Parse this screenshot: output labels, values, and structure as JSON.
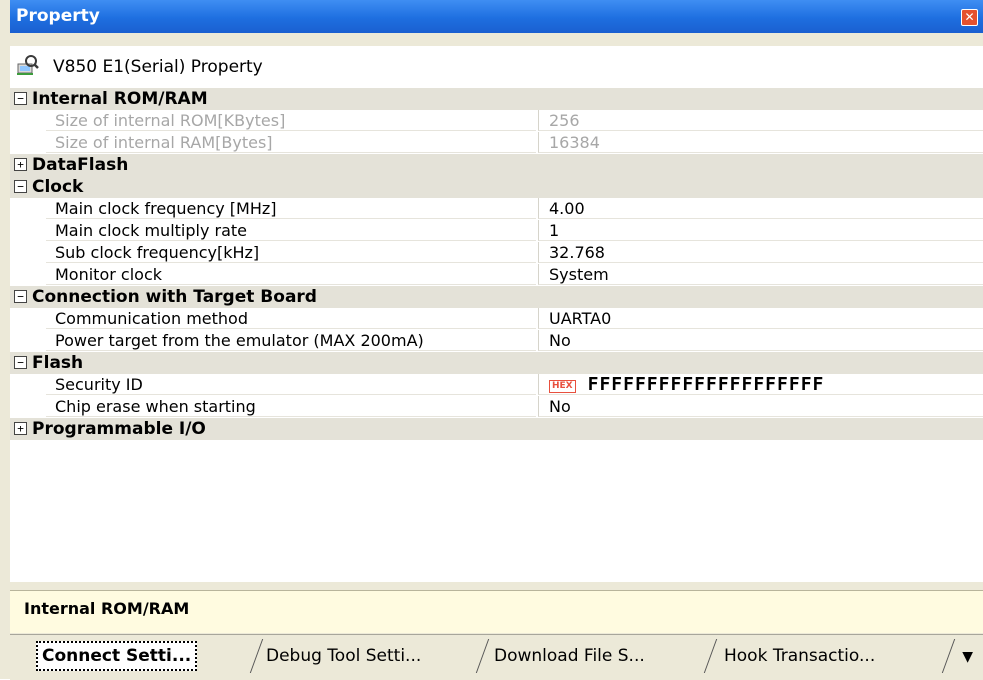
{
  "window": {
    "title": "Property",
    "close_glyph": "✕"
  },
  "header": {
    "title": "V850 E1(Serial) Property",
    "icon": "property-icon"
  },
  "categories": {
    "internal": {
      "toggle": "−",
      "label": "Internal ROM/RAM"
    },
    "dataflash": {
      "toggle": "+",
      "label": "DataFlash"
    },
    "clock": {
      "toggle": "−",
      "label": "Clock"
    },
    "connection": {
      "toggle": "−",
      "label": "Connection with Target Board"
    },
    "flash": {
      "toggle": "−",
      "label": "Flash"
    },
    "pio": {
      "toggle": "+",
      "label": "Programmable I/O"
    }
  },
  "props": {
    "rom_size": {
      "name": "Size of internal ROM[KBytes]",
      "value": "256"
    },
    "ram_size": {
      "name": "Size of internal RAM[Bytes]",
      "value": "16384"
    },
    "main_freq": {
      "name": "Main clock frequency [MHz]",
      "value": "4.00"
    },
    "main_mult": {
      "name": "Main clock multiply rate",
      "value": "1"
    },
    "sub_freq": {
      "name": "Sub clock frequency[kHz]",
      "value": "32.768"
    },
    "monitor_clock": {
      "name": "Monitor clock",
      "value": "System"
    },
    "comm_method": {
      "name": "Communication method",
      "value": "UARTA0"
    },
    "power_target": {
      "name": "Power target from the emulator (MAX 200mA)",
      "value": "No"
    },
    "security_id": {
      "name": "Security ID",
      "badge": "HEX",
      "value": "FFFFFFFFFFFFFFFFFFFF"
    },
    "chip_erase": {
      "name": "Chip erase when starting",
      "value": "No"
    }
  },
  "description": {
    "text": "Internal ROM/RAM"
  },
  "tabs": [
    {
      "label": "Connect Setti...",
      "active": true
    },
    {
      "label": "Debug Tool Setti...",
      "active": false
    },
    {
      "label": "Download File S...",
      "active": false
    },
    {
      "label": "Hook Transactio...",
      "active": false
    }
  ],
  "tabs_overflow_glyph": "▼"
}
